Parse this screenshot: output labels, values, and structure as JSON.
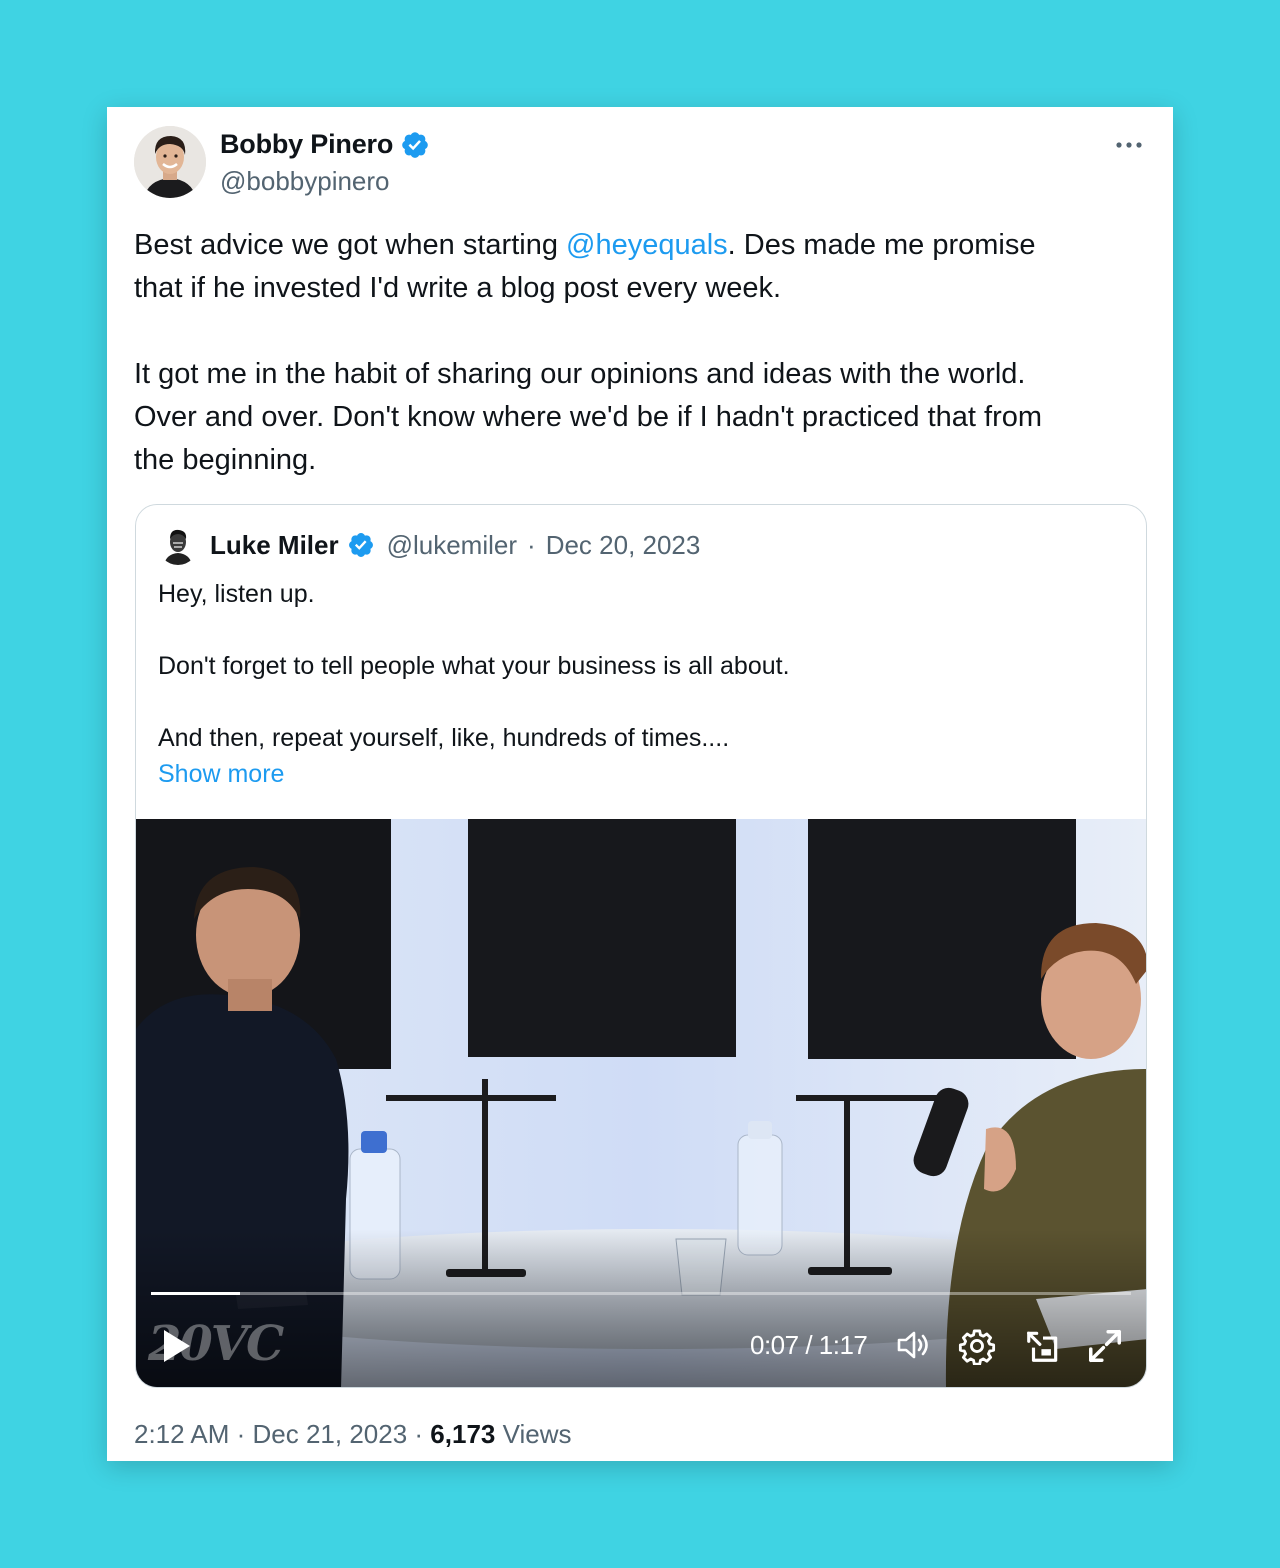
{
  "tweet": {
    "author_name": "Bobby Pinero",
    "author_handle": "@bobbypinero",
    "more_icon": "ellipsis-icon",
    "verified_icon": "verified-badge-icon",
    "text": {
      "p1_before": "Best advice we got when starting ",
      "p1_mention": "@heyequals",
      "p1_line1_after": ". Des made me promise",
      "p1_line2": "that if he invested I'd write a blog post every week.",
      "p2_line1": "It got me in the habit of sharing our opinions and ideas with the world.",
      "p2_line2": "Over and over. Don't know where we'd be if I hadn't practiced that from",
      "p2_line3": "the beginning."
    },
    "footer": {
      "time": "2:12 AM",
      "separator": " · ",
      "date": "Dec 21, 2023",
      "views_count": "6,173",
      "views_label": "Views"
    }
  },
  "quote": {
    "author_name": "Luke Miler",
    "author_handle": "@lukemiler",
    "separator": "·",
    "date": "Dec 20, 2023",
    "lines": {
      "l1": "Hey, listen up.",
      "l2": "Don't forget to tell people what your business is all about.",
      "l3": "And then, repeat yourself, like, hundreds of times...."
    },
    "show_more": "Show more",
    "video": {
      "watermark": "20VC",
      "current_time": "0:07",
      "duration": "1:17",
      "time_separator": " / ",
      "progress_fraction": 0.091,
      "icons": [
        "play-icon",
        "volume-icon",
        "settings-icon",
        "pip-icon",
        "fullscreen-icon"
      ]
    }
  },
  "colors": {
    "background": "#3fd3e3",
    "link": "#1d9bf0",
    "secondary_text": "#536471",
    "border": "#cfd9de"
  }
}
